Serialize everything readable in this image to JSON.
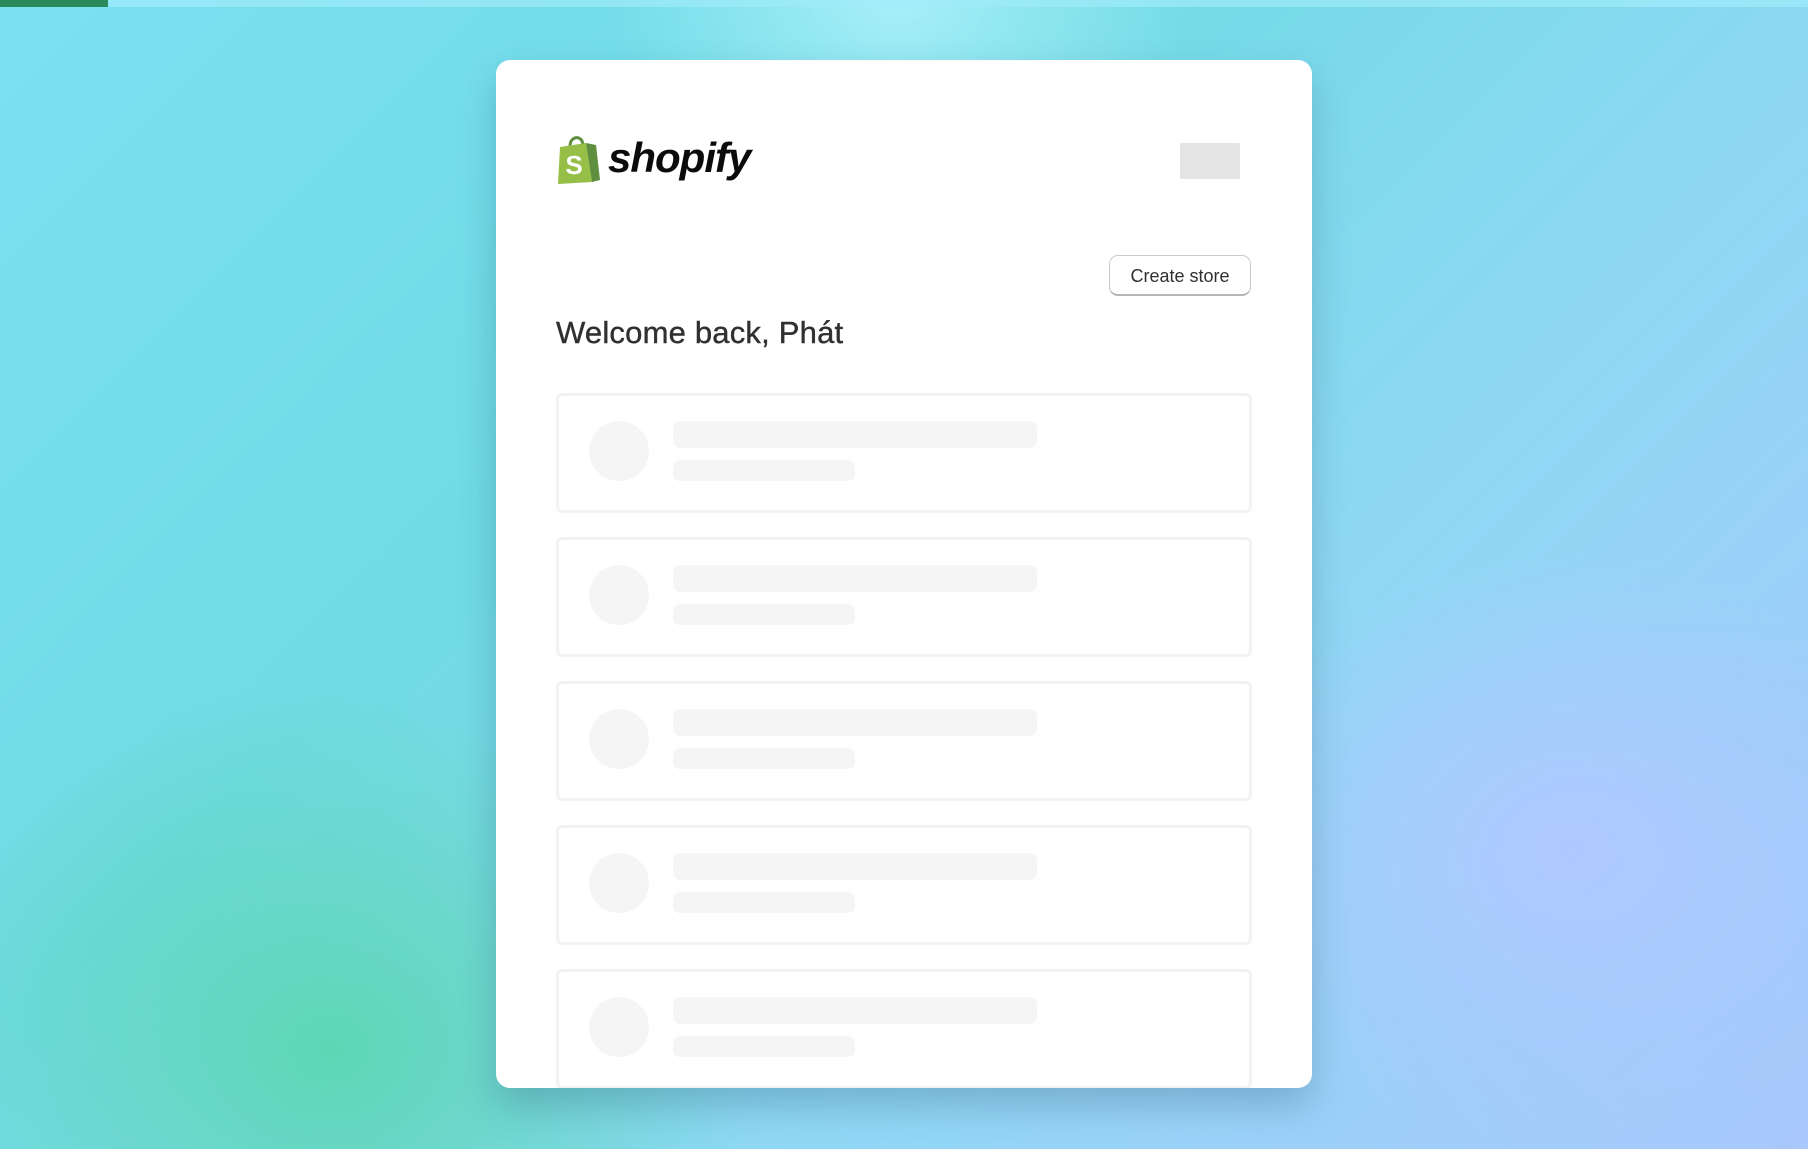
{
  "progress": {
    "fraction": 0.06
  },
  "brand": {
    "name": "shopify",
    "logo_icon": "shopify-bag-icon",
    "bag_color": "#95bf47",
    "bag_shade_color": "#5e8e3e"
  },
  "header": {
    "welcome_text": "Welcome back, Phát",
    "create_store_label": "Create store"
  },
  "store_list": {
    "loading": true,
    "skeleton_count": 5
  },
  "colors": {
    "progress_fill": "#2b8a5c",
    "card_background": "#ffffff",
    "skeleton": "#f5f5f5"
  }
}
